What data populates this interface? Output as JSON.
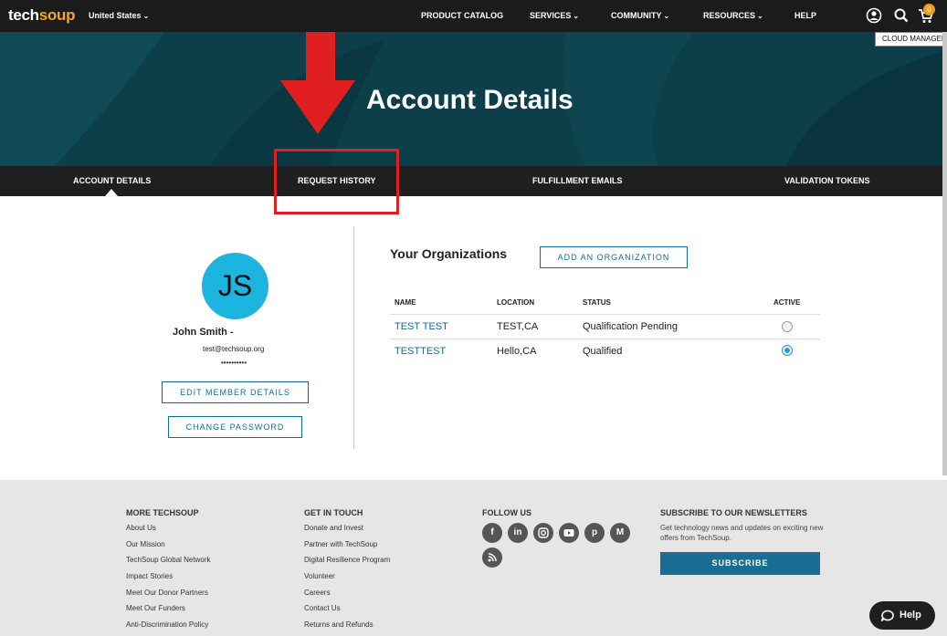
{
  "topnav": {
    "logo_tech": "tech",
    "logo_soup": "soup",
    "region": "United States",
    "items": [
      "PRODUCT CATALOG",
      "SERVICES",
      "COMMUNITY",
      "RESOURCES",
      "HELP"
    ],
    "cart_count": "0"
  },
  "hero": {
    "title": "Account Details",
    "cloud_manager": "CLOUD MANAGER"
  },
  "tabs": [
    "ACCOUNT DETAILS",
    "REQUEST HISTORY",
    "FULFILLMENT EMAILS",
    "VALIDATION TOKENS"
  ],
  "profile": {
    "initials": "JS",
    "name": "John Smith -",
    "email": "test@techsoup.org",
    "password_mask": "••••••••••",
    "edit_button": "EDIT MEMBER DETAILS",
    "change_password_button": "CHANGE PASSWORD"
  },
  "organizations": {
    "title": "Your Organizations",
    "add_button": "ADD AN ORGANIZATION",
    "columns": [
      "NAME",
      "LOCATION",
      "STATUS",
      "ACTIVE"
    ],
    "rows": [
      {
        "name": "TEST TEST",
        "location": "TEST,CA",
        "status": "Qualification Pending",
        "active": false
      },
      {
        "name": "TESTTEST",
        "location": "Hello,CA",
        "status": "Qualified",
        "active": true
      }
    ]
  },
  "footer": {
    "more": {
      "heading": "MORE TECHSOUP",
      "links": [
        "About Us",
        "Our Mission",
        "TechSoup Global Network",
        "Impact Stories",
        "Meet Our Donor Partners",
        "Meet Our Funders",
        "Anti-Discrimination Policy"
      ]
    },
    "touch": {
      "heading": "GET IN TOUCH",
      "links": [
        "Donate and Invest",
        "Partner with TechSoup",
        "Digital Resilience Program",
        "Volunteer",
        "Careers",
        "Contact Us",
        "Returns and Refunds"
      ]
    },
    "follow": {
      "heading": "FOLLOW US",
      "icons": [
        "facebook-icon",
        "linkedin-icon",
        "instagram-icon",
        "youtube-icon",
        "pinterest-icon",
        "medium-icon",
        "rss-icon"
      ]
    },
    "subscribe": {
      "heading": "SUBSCRIBE TO OUR NEWSLETTERS",
      "text": "Get technology news and updates on exciting new offers from TechSoup.",
      "button": "SUBSCRIBE"
    }
  },
  "help_button": "Help",
  "colors": {
    "accent": "#0e6f96",
    "brand_orange": "#f5a623",
    "hero_bg": "#0c3f4a",
    "annotation_red": "#e02020"
  }
}
